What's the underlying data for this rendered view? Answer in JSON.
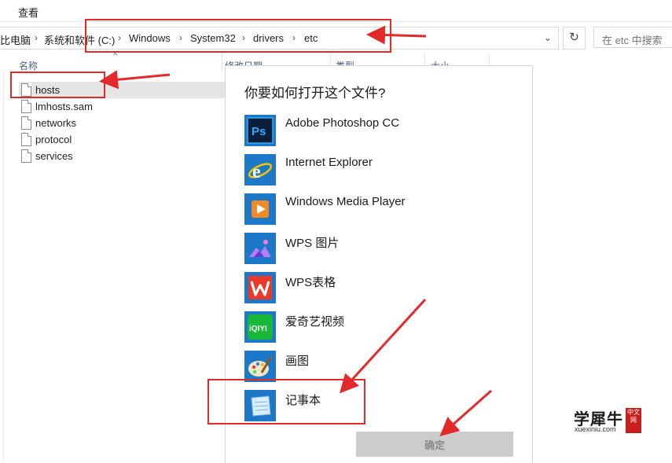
{
  "ribbon": {
    "tab_view": "查看"
  },
  "address_bar": {
    "crumbs": [
      "比电脑",
      "系统和软件 (C:)",
      "Windows",
      "System32",
      "drivers",
      "etc"
    ]
  },
  "search": {
    "placeholder": "在 etc 中搜索"
  },
  "columns": {
    "name": "名称",
    "modified": "修改日期",
    "type": "类型",
    "size": "大小"
  },
  "files": [
    {
      "name": "hosts",
      "selected": true
    },
    {
      "name": "lmhosts.sam",
      "selected": false
    },
    {
      "name": "networks",
      "selected": false
    },
    {
      "name": "protocol",
      "selected": false
    },
    {
      "name": "services",
      "selected": false
    }
  ],
  "dialog": {
    "title": "你要如何打开这个文件?",
    "apps": [
      {
        "label": "Adobe Photoshop CC",
        "icon": "photoshop-icon"
      },
      {
        "label": "Internet Explorer",
        "icon": "internet-explorer-icon"
      },
      {
        "label": "Windows Media Player",
        "icon": "media-player-icon"
      },
      {
        "label": "WPS 图片",
        "icon": "wps-picture-icon"
      },
      {
        "label": "WPS表格",
        "icon": "wps-spreadsheet-icon"
      },
      {
        "label": "爱奇艺视频",
        "icon": "iqiyi-icon"
      },
      {
        "label": "画图",
        "icon": "paint-icon"
      },
      {
        "label": "记事本",
        "icon": "notepad-icon"
      }
    ],
    "ok_label": "确定"
  },
  "watermark": {
    "main": "学犀牛",
    "sub": "xuexiniu.com",
    "seal": "中文网"
  },
  "colors": {
    "accent": "#1e78c8",
    "annotation_red": "#e22a2a"
  }
}
